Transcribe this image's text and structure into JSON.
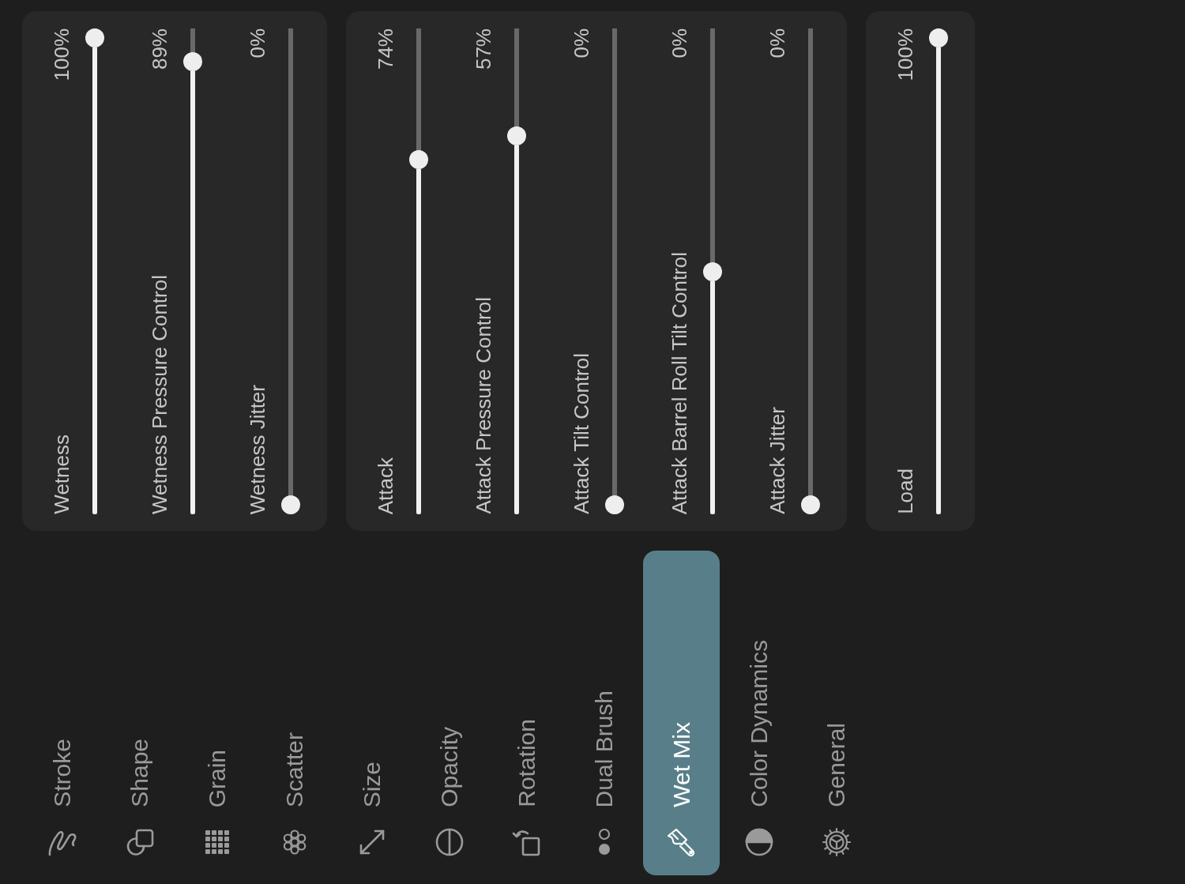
{
  "panels": [
    {
      "sliders": [
        {
          "label": "Wetness",
          "value": "100%",
          "level": 1
        },
        {
          "label": "Wetness Pressure Control",
          "value": "89%",
          "level": 0.95
        },
        {
          "label": "Wetness Jitter",
          "value": "0%",
          "level": 0
        }
      ]
    },
    {
      "sliders": [
        {
          "label": "Attack",
          "value": "74%",
          "level": 0.74
        },
        {
          "label": "Attack Pressure Control",
          "value": "57%",
          "level": 0.79
        },
        {
          "label": "Attack Tilt Control",
          "value": "0%",
          "level": 0
        },
        {
          "label": "Attack Barrel Roll Tilt Control",
          "value": "0%",
          "level": 0.5
        },
        {
          "label": "Attack Jitter",
          "value": "0%",
          "level": 0
        }
      ]
    },
    {
      "sliders": [
        {
          "label": "Load",
          "value": "100%",
          "level": 1
        }
      ]
    }
  ],
  "tabs": [
    {
      "label": "Stroke",
      "selected": false
    },
    {
      "label": "Shape",
      "selected": false
    },
    {
      "label": "Grain",
      "selected": false
    },
    {
      "label": "Scatter",
      "selected": false
    },
    {
      "label": "Size",
      "selected": false
    },
    {
      "label": "Opacity",
      "selected": false
    },
    {
      "label": "Rotation",
      "selected": false
    },
    {
      "label": "Dual Brush",
      "selected": false
    },
    {
      "label": "Wet Mix",
      "selected": true
    },
    {
      "label": "Color Dynamics",
      "selected": false
    },
    {
      "label": "General",
      "selected": false
    }
  ]
}
